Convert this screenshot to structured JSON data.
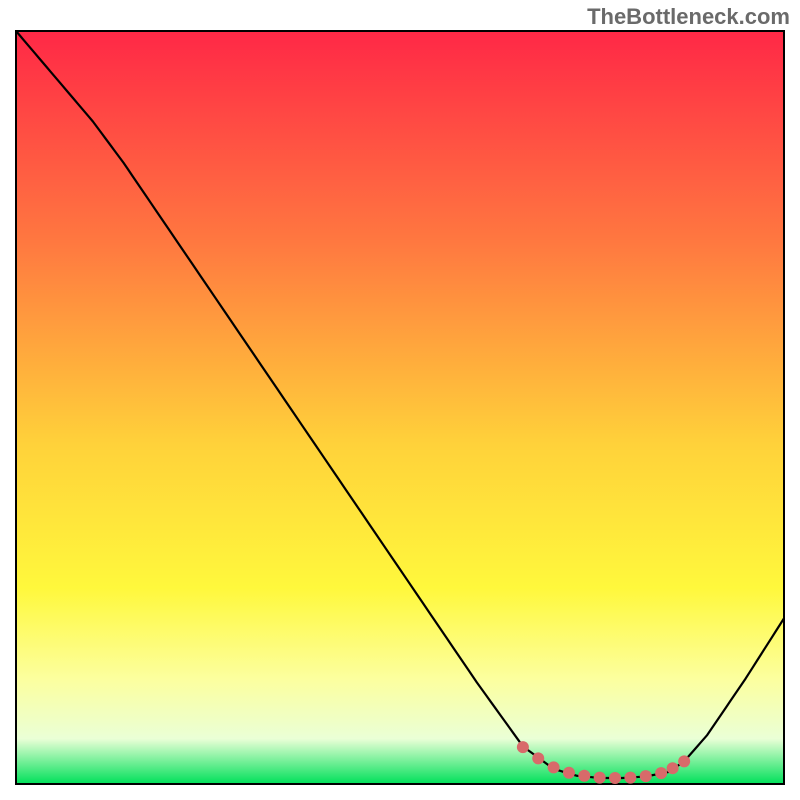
{
  "watermark": "TheBottleneck.com",
  "chart_data": {
    "type": "line",
    "title": "",
    "xlabel": "",
    "ylabel": "",
    "xlim": [
      0,
      100
    ],
    "ylim": [
      0,
      100
    ],
    "colors": {
      "gradient_top": "#ff2846",
      "gradient_mid1": "#ff7840",
      "gradient_mid2": "#ffd23a",
      "gradient_mid3": "#fff83c",
      "gradient_mid4": "#fcff9e",
      "gradient_mid5": "#eaffd6",
      "gradient_bottom": "#00e05a",
      "frame": "#000000",
      "curve": "#000000",
      "marker": "#d86a6a"
    },
    "series": [
      {
        "name": "bottleneck-curve",
        "x": [
          0,
          5,
          10,
          14,
          20,
          30,
          40,
          50,
          60,
          66,
          70,
          73,
          76,
          79,
          82,
          85,
          87,
          90,
          95,
          100
        ],
        "y": [
          100,
          94,
          88,
          82.5,
          73.5,
          58.5,
          43.5,
          28.5,
          13.5,
          5,
          2,
          1.1,
          0.8,
          0.8,
          1,
          1.6,
          3,
          6.5,
          14,
          22
        ]
      }
    ],
    "markers": {
      "name": "highlight-points",
      "x": [
        66,
        68,
        70,
        72,
        74,
        76,
        78,
        80,
        82,
        84,
        85.5,
        87
      ],
      "y": [
        4.9,
        3.4,
        2.2,
        1.5,
        1.1,
        0.85,
        0.8,
        0.85,
        1.05,
        1.45,
        2.1,
        3.0
      ]
    }
  }
}
